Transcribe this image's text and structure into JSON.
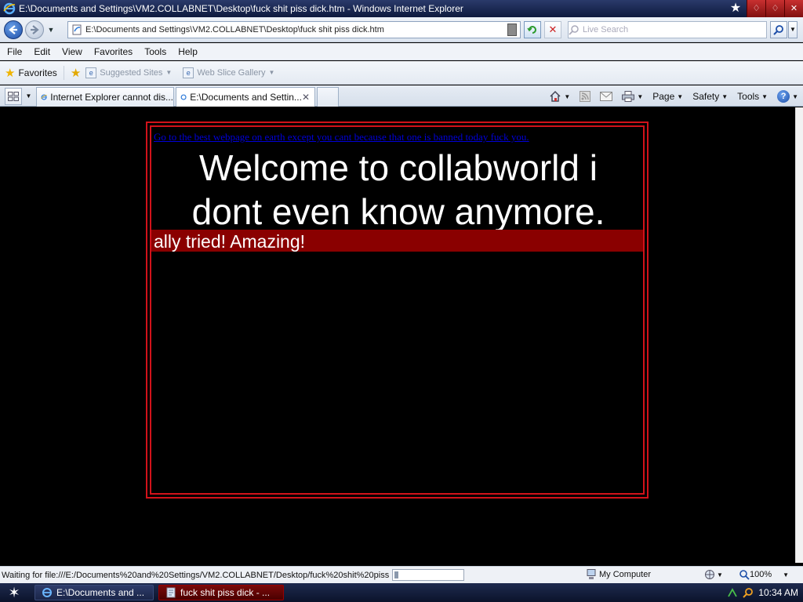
{
  "window": {
    "title": "E:\\Documents and Settings\\VM2.COLLABNET\\Desktop\\fuck shit piss dick.htm - Windows Internet Explorer",
    "min_label": "♢",
    "max_label": "♢",
    "close_label": "✕"
  },
  "address": {
    "url": "E:\\Documents and Settings\\VM2.COLLABNET\\Desktop\\fuck shit piss dick.htm",
    "stop_label": "✕"
  },
  "search": {
    "placeholder": "Live Search"
  },
  "menu": {
    "items": [
      "File",
      "Edit",
      "View",
      "Favorites",
      "Tools",
      "Help"
    ]
  },
  "favorites": {
    "label": "Favorites",
    "items": [
      {
        "label": "Suggested Sites"
      },
      {
        "label": "Web Slice Gallery"
      }
    ]
  },
  "tabs": {
    "items": [
      {
        "label": "Internet Explorer cannot dis..."
      },
      {
        "label": "E:\\Documents and Settin..."
      }
    ],
    "close_label": "✕"
  },
  "command_bar": {
    "page": "Page",
    "safety": "Safety",
    "tools": "Tools",
    "help": "?"
  },
  "page": {
    "link_text": "Go to the best webpage on earth except you cant because that one is banned today fuck you.",
    "heading": "Welcome to collabworld i dont even know anymore.",
    "marquee": "ally tried! Amazing!"
  },
  "status": {
    "text": "Waiting for file:///E:/Documents%20and%20Settings/VM2.COLLABNET/Desktop/fuck%20shit%20piss%",
    "progress": 0.05,
    "zone": "My Computer",
    "zoom": "100%"
  },
  "taskbar": {
    "items": [
      {
        "label": "E:\\Documents and ..."
      },
      {
        "label": "fuck shit piss dick - ..."
      }
    ],
    "clock": "10:34 AM"
  },
  "colors": {
    "frame_red": "#d1121a",
    "marquee_bg": "#8a0000",
    "link_blue": "#0000d8"
  }
}
